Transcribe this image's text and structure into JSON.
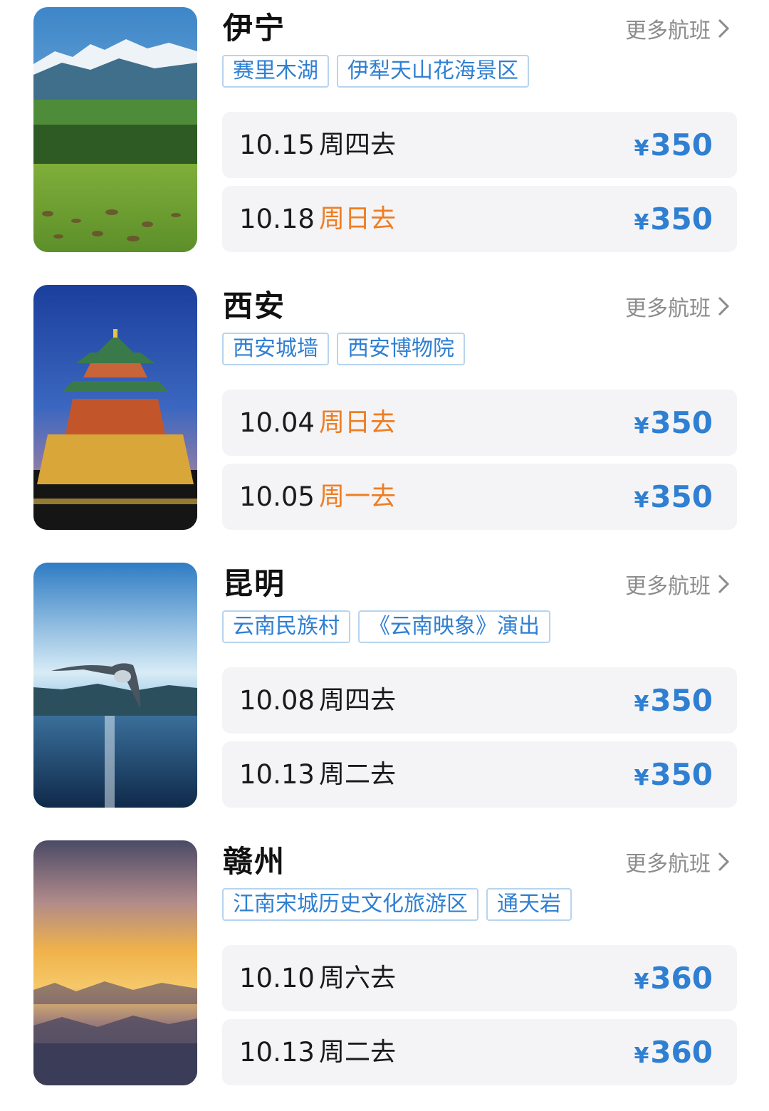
{
  "destinations": [
    {
      "city": "伊宁",
      "more_label": "更多航班",
      "image": "grassland-snow-mountain-photo",
      "tags": [
        "赛里木湖",
        "伊犁天山花海景区"
      ],
      "flights": [
        {
          "date": "10.15",
          "day": "周四去",
          "highlight": false,
          "currency": "¥",
          "price": "350"
        },
        {
          "date": "10.18",
          "day": "周日去",
          "highlight": true,
          "currency": "¥",
          "price": "350"
        }
      ]
    },
    {
      "city": "西安",
      "more_label": "更多航班",
      "image": "bell-tower-night-photo",
      "tags": [
        "西安城墙",
        "西安博物院"
      ],
      "flights": [
        {
          "date": "10.04",
          "day": "周日去",
          "highlight": true,
          "currency": "¥",
          "price": "350"
        },
        {
          "date": "10.05",
          "day": "周一去",
          "highlight": true,
          "currency": "¥",
          "price": "350"
        }
      ]
    },
    {
      "city": "昆明",
      "more_label": "更多航班",
      "image": "seagull-lake-photo",
      "tags": [
        "云南民族村",
        "《云南映象》演出"
      ],
      "flights": [
        {
          "date": "10.08",
          "day": "周四去",
          "highlight": false,
          "currency": "¥",
          "price": "350"
        },
        {
          "date": "10.13",
          "day": "周二去",
          "highlight": false,
          "currency": "¥",
          "price": "350"
        }
      ]
    },
    {
      "city": "赣州",
      "more_label": "更多航班",
      "image": "sunset-sea-of-clouds-photo",
      "tags": [
        "江南宋城历史文化旅游区",
        "通天岩"
      ],
      "flights": [
        {
          "date": "10.10",
          "day": "周六去",
          "highlight": false,
          "currency": "¥",
          "price": "360"
        },
        {
          "date": "10.13",
          "day": "周二去",
          "highlight": false,
          "currency": "¥",
          "price": "360"
        }
      ]
    }
  ],
  "colors": {
    "accent_blue": "#2f7fd2",
    "weekend_orange": "#ef7d22",
    "row_bg": "#f4f4f6",
    "muted": "#8c8c8c"
  }
}
